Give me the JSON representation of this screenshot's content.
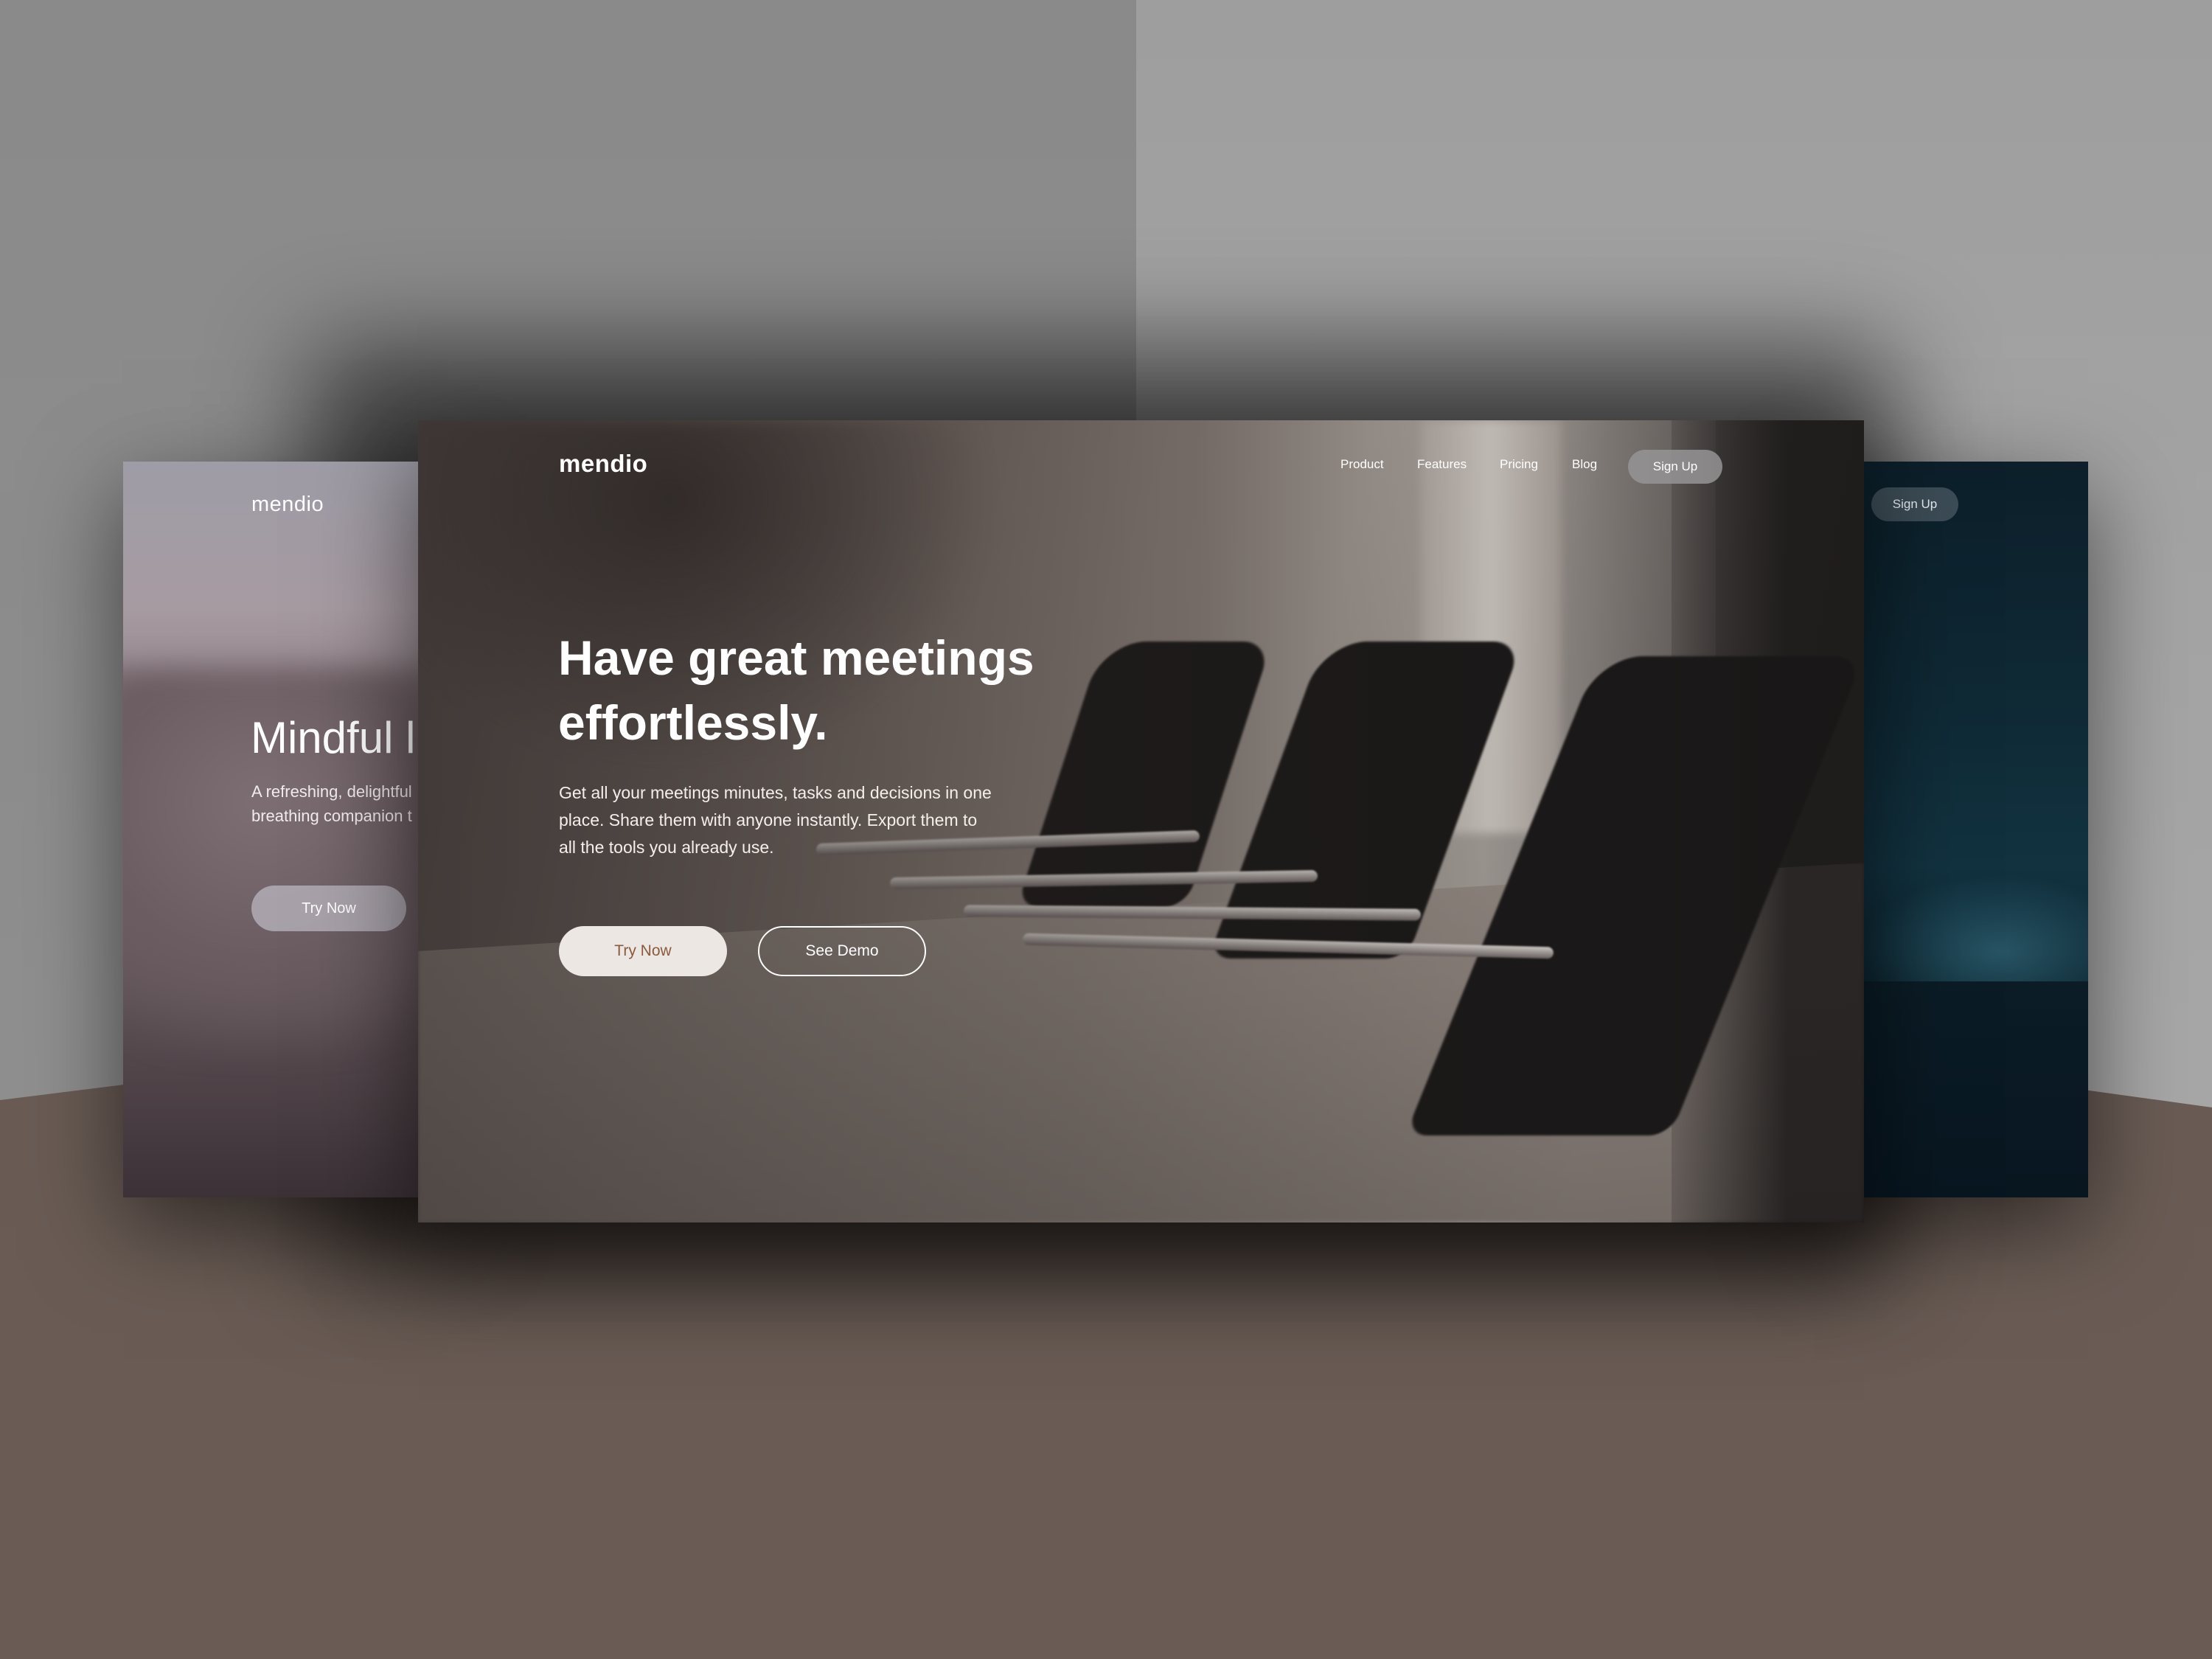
{
  "left_mockup": {
    "logo": "mendio",
    "headline": "Mindful l",
    "subtitle_line1": "A refreshing, delightful",
    "subtitle_line2": "breathing companion t",
    "cta_label": "Try Now"
  },
  "main_mockup": {
    "logo": "mendio",
    "nav": {
      "product": "Product",
      "features": "Features",
      "pricing": "Pricing",
      "blog": "Blog",
      "signup": "Sign Up"
    },
    "hero": {
      "title_line1": "Have great meetings",
      "title_line2": "effortlessly.",
      "subtitle_line1": "Get all your meetings minutes, tasks and decisions in one",
      "subtitle_line2": "place. Share them with anyone instantly. Export them to",
      "subtitle_line3": "all the tools you already use.",
      "primary_cta": "Try Now",
      "secondary_cta": "See Demo"
    },
    "colors": {
      "primary_cta_bg": "#ece7e3",
      "primary_cta_text": "#8a5a3c"
    }
  },
  "right_mockup": {
    "signup_label": "Sign Up"
  }
}
